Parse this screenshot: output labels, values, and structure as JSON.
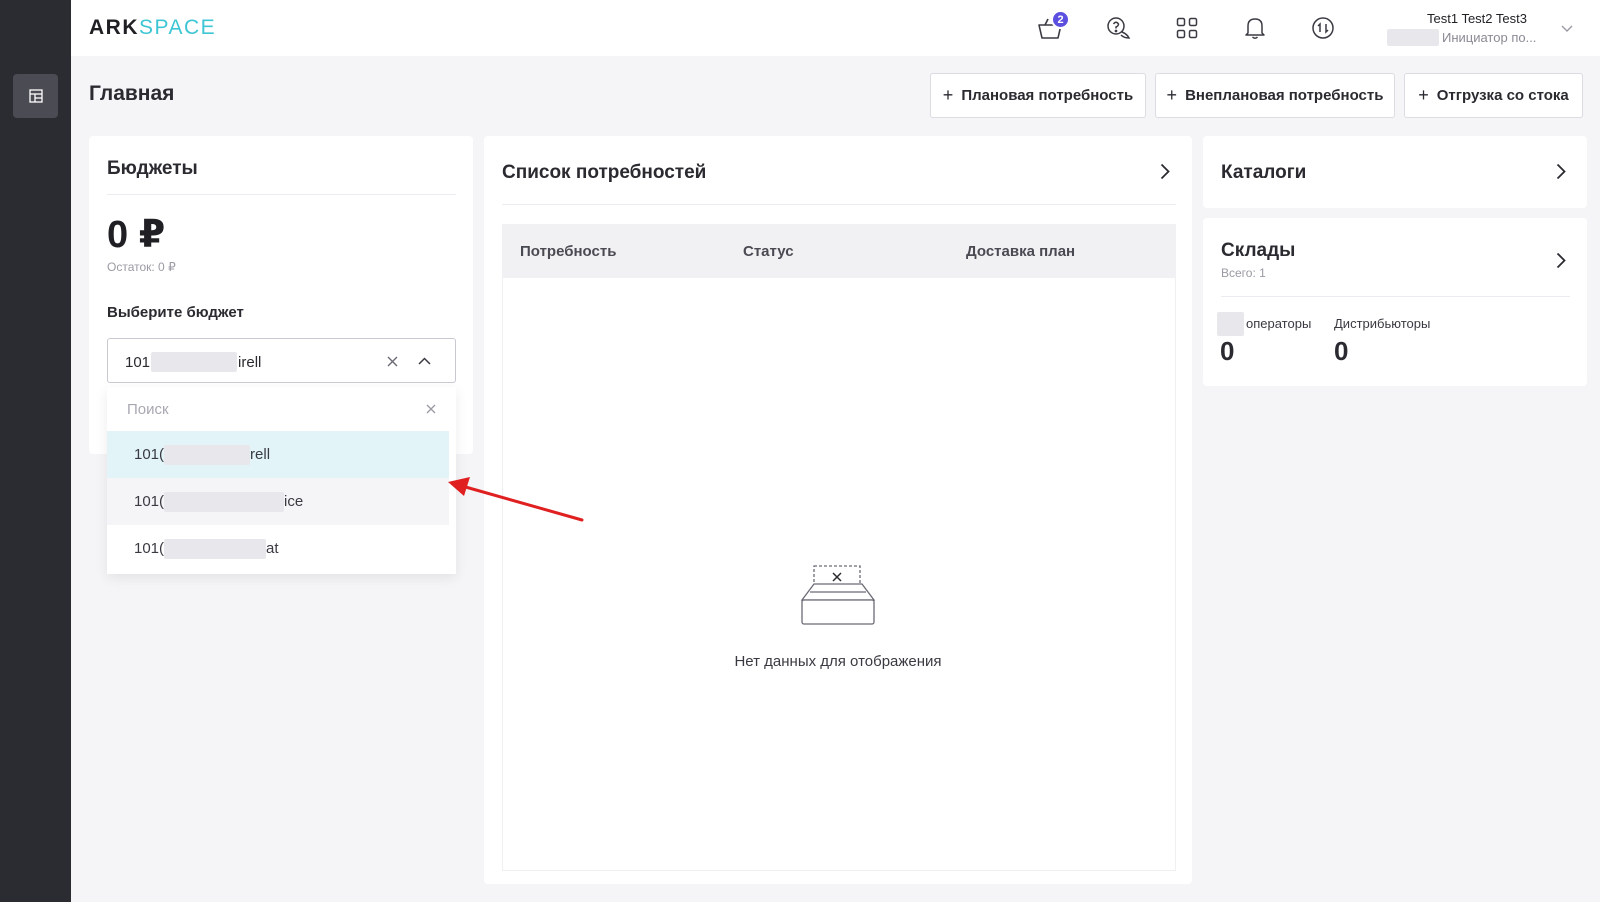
{
  "logo": {
    "part1": "ARK",
    "part2": "SPACE"
  },
  "header": {
    "cart_badge": "2",
    "user_name": "Test1 Test2 Test3",
    "user_role": "Инициатор по..."
  },
  "page": {
    "title": "Главная",
    "actions": [
      {
        "label": "Плановая потребность"
      },
      {
        "label": "Внеплановая потребность"
      },
      {
        "label": "Отгрузка со стока"
      }
    ]
  },
  "budgets": {
    "title": "Бюджеты",
    "amount": "0 ₽",
    "remaining": "Остаток: 0 ₽",
    "select_label": "Выберите бюджет",
    "selected_prefix": "101",
    "selected_suffix": "irell",
    "search_placeholder": "Поиск",
    "options": [
      {
        "prefix": "101(",
        "suffix": "rell"
      },
      {
        "prefix": "101(",
        "suffix": "ice"
      },
      {
        "prefix": "101(",
        "suffix": "at"
      }
    ]
  },
  "needs": {
    "title": "Список потребностей",
    "columns": [
      "Потребность",
      "Статус",
      "Доставка план"
    ],
    "empty": "Нет данных для отображения"
  },
  "catalogs": {
    "title": "Каталоги"
  },
  "warehouses": {
    "title": "Склады",
    "total": "Всего: 1",
    "stats": [
      {
        "label": "операторы",
        "value": "0"
      },
      {
        "label": "Дистрибьюторы",
        "value": "0"
      }
    ]
  },
  "colors": {
    "accent": "#3ec6d4",
    "badge": "#5b4fe0",
    "highlight": "#e3f4f8",
    "arrow": "#e02020"
  }
}
